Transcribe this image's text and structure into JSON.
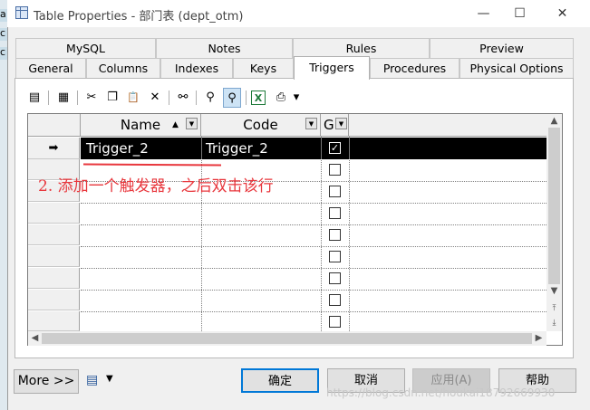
{
  "window": {
    "title": "Table Properties - 部门表 (dept_otm)",
    "minimize_glyph": "—",
    "maximize_glyph": "☐",
    "close_glyph": "✕"
  },
  "backdrop_text": [
    "a",
    "c",
    "c"
  ],
  "tabs": {
    "row1": [
      "MySQL",
      "Notes",
      "Rules",
      "Preview"
    ],
    "row2": [
      "General",
      "Columns",
      "Indexes",
      "Keys",
      "Triggers",
      "Procedures",
      "Physical Options"
    ],
    "active": "Triggers"
  },
  "toolbar": {
    "icons": [
      "properties-icon",
      "add-row-icon",
      "cut-icon",
      "copy-icon",
      "paste-icon",
      "delete-icon",
      "find-icon",
      "filter-icon",
      "filter-clear-icon",
      "excel-icon",
      "print-icon",
      "dropdown-icon"
    ],
    "glyphs": {
      "properties": "▤",
      "add_row": "▦",
      "cut": "✂",
      "copy": "❐",
      "paste": "📋",
      "delete": "✕",
      "find": "⚯",
      "filter": "⚲",
      "filter_clear": "⚲",
      "excel": "X",
      "print": "⎙",
      "dropdown": "▾"
    }
  },
  "grid": {
    "columns": [
      {
        "label": "Name",
        "sort": "▲"
      },
      {
        "label": "Code",
        "sort": ""
      },
      {
        "label": "G",
        "sort": ""
      }
    ],
    "selected_row_marker": "➡",
    "rows": [
      {
        "name": "Trigger_2",
        "code": "Trigger_2",
        "g": true
      }
    ],
    "empty_rows": 8
  },
  "annotation": "2. 添加一个触发器，之后双击该行",
  "buttons": {
    "more": "More >>",
    "ok": "确定",
    "cancel": "取消",
    "apply": "应用(A)",
    "help": "帮助"
  },
  "watermark": "https://blog.csdn.net/houkai18792669930",
  "colors": {
    "accent": "#0078d7",
    "annotation": "#e8373d",
    "selected_row": "#000000"
  }
}
